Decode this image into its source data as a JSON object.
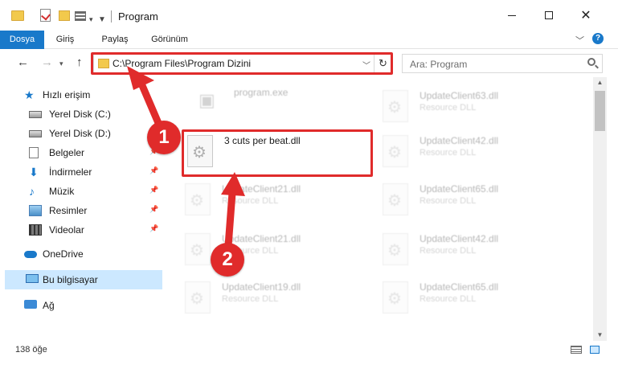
{
  "window": {
    "title": "Program"
  },
  "ribbon": {
    "tabs": [
      "Dosya",
      "Giriş",
      "Paylaş",
      "Görünüm"
    ],
    "help": "?"
  },
  "navigation": {
    "address": "C:\\Program Files\\Program Dizini",
    "search_placeholder": "Ara: Program"
  },
  "sidebar": {
    "items": [
      {
        "label": "Hızlı erişim",
        "icon": "star-icon"
      },
      {
        "label": "Yerel Disk (C:)",
        "icon": "drive-icon"
      },
      {
        "label": "Yerel Disk (D:)",
        "icon": "drive-icon"
      },
      {
        "label": "Belgeler",
        "icon": "document-icon"
      },
      {
        "label": "İndirmeler",
        "icon": "download-icon"
      },
      {
        "label": "Müzik",
        "icon": "music-icon"
      },
      {
        "label": "Resimler",
        "icon": "pictures-icon"
      },
      {
        "label": "Videolar",
        "icon": "video-icon"
      },
      {
        "label": "OneDrive",
        "icon": "cloud-icon"
      },
      {
        "label": "Bu bilgisayar",
        "icon": "computer-icon"
      },
      {
        "label": "Ağ",
        "icon": "network-icon"
      }
    ]
  },
  "files": {
    "left": [
      {
        "name": "program.exe",
        "type": ""
      },
      {
        "name": "3 cuts per beat.dll",
        "type": ""
      },
      {
        "name": "UpdateClient21.dll",
        "type": "Resource DLL"
      },
      {
        "name": "UpdateClient21.dll",
        "type": "Resource DLL"
      },
      {
        "name": "UpdateClient19.dll",
        "type": "Resource DLL"
      }
    ],
    "right": [
      {
        "name": "UpdateClient63.dll",
        "type": "Resource DLL"
      },
      {
        "name": "UpdateClient42.dll",
        "type": "Resource DLL"
      },
      {
        "name": "UpdateClient65.dll",
        "type": "Resource DLL"
      },
      {
        "name": "UpdateClient42.dll",
        "type": "Resource DLL"
      },
      {
        "name": "UpdateClient65.dll",
        "type": "Resource DLL"
      }
    ]
  },
  "status": {
    "item_count": "138 öğe"
  },
  "annotations": {
    "step1": "1",
    "step2": "2",
    "highlight_color": "#e02b2b"
  },
  "colors": {
    "accent": "#1979ca",
    "selection": "#cce8ff"
  }
}
